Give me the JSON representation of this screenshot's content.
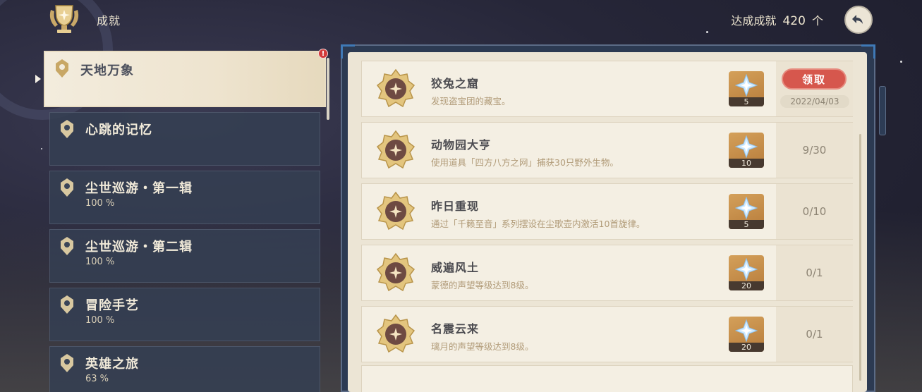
{
  "header": {
    "title": "成就",
    "count_prefix": "达成成就",
    "count_value": "420",
    "count_suffix": "个"
  },
  "categories": [
    {
      "name": "天地万象",
      "pct": "",
      "selected": true
    },
    {
      "name": "心跳的记忆",
      "pct": ""
    },
    {
      "name": "尘世巡游・第一辑",
      "pct": "100 %"
    },
    {
      "name": "尘世巡游・第二辑",
      "pct": "100 %"
    },
    {
      "name": "冒险手艺",
      "pct": "100 %"
    },
    {
      "name": "英雄之旅",
      "pct": "63 %"
    }
  ],
  "badge": "!",
  "achievements": [
    {
      "title": "狡兔之窟",
      "desc": "发现盗宝团的藏宝。",
      "reward_qty": "5",
      "claim_label": "领取",
      "date": "2022/04/03"
    },
    {
      "title": "动物园大亨",
      "desc": "使用道具「四方八方之网」捕获30只野外生物。",
      "reward_qty": "10",
      "progress": "9/30"
    },
    {
      "title": "昨日重现",
      "desc": "通过「千籁至音」系列摆设在尘歌壶内激活10首旋律。",
      "reward_qty": "5",
      "progress": "0/10"
    },
    {
      "title": "威遍风土",
      "desc": "蒙德的声望等级达到8级。",
      "reward_qty": "20",
      "progress": "0/1"
    },
    {
      "title": "名震云来",
      "desc": "璃月的声望等级达到8级。",
      "reward_qty": "20",
      "progress": "0/1"
    }
  ],
  "colors": {
    "claim_button": "#d6574d",
    "panel_bg": "#ece5d5",
    "category_bg": "#343f52",
    "reward_bg": "#c48b46"
  },
  "icons": {
    "header": "trophy-icon",
    "back": "back-arrow-icon",
    "reward": "primogem-icon",
    "medal": "achievement-medal-icon",
    "category": "category-emblem-icon"
  }
}
